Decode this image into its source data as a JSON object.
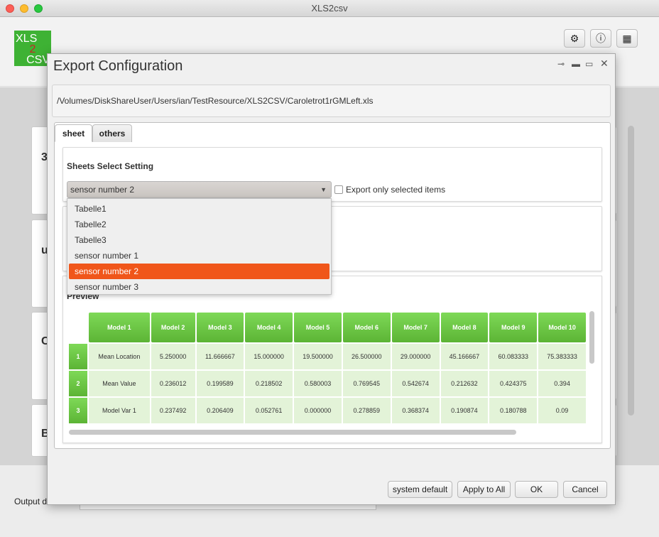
{
  "window": {
    "title": "XLS2csv"
  },
  "logo": {
    "line1": "XLS",
    "line2": "2",
    "line3": "CSV"
  },
  "header_icons": [
    "gear-icon",
    "alert-icon",
    "grid-icon"
  ],
  "background": {
    "letters": [
      "3",
      "u",
      "C",
      "B"
    ],
    "output_label": "Output d"
  },
  "dialog": {
    "title": "Export Configuration",
    "path": "/Volumes/DiskShareUser/Users/ian/TestResource/XLS2CSV/Caroletrot1rGMLeft.xls",
    "tabs": [
      {
        "label": "sheet",
        "active": true
      },
      {
        "label": "others",
        "active": false
      }
    ],
    "sheets_section_title": "Sheets Select Setting",
    "combo_value": "sensor number 2",
    "export_only_label": "Export only selected items",
    "export_only_checked": false,
    "dropdown_items": [
      "Tabelle1",
      "Tabelle2",
      "Tabelle3",
      "sensor number 1",
      "sensor number 2",
      "sensor number 3"
    ],
    "dropdown_selected_index": 4,
    "preview_title": "Preview",
    "table": {
      "headers": [
        "Model 1",
        "Model 2",
        "Model 3",
        "Model 4",
        "Model 5",
        "Model 6",
        "Model 7",
        "Model 8",
        "Model 9",
        "Model 10"
      ],
      "rows": [
        {
          "num": "1",
          "cells": [
            "Mean Location",
            "5.250000",
            "11.666667",
            "15.000000",
            "19.500000",
            "26.500000",
            "29.000000",
            "45.166667",
            "60.083333",
            "75.383333"
          ]
        },
        {
          "num": "2",
          "cells": [
            "Mean Value",
            "0.236012",
            "0.199589",
            "0.218502",
            "0.580003",
            "0.769545",
            "0.542674",
            "0.212632",
            "0.424375",
            "0.394"
          ]
        },
        {
          "num": "3",
          "cells": [
            "Model Var 1",
            "0.237492",
            "0.206409",
            "0.052761",
            "0.000000",
            "0.278859",
            "0.368374",
            "0.190874",
            "0.180788",
            "0.09"
          ]
        }
      ]
    },
    "buttons": {
      "system_default": "system default",
      "apply_all": "Apply to All",
      "ok": "OK",
      "cancel": "Cancel"
    },
    "accent_color": "#f0561a",
    "header_green": "#6cc744"
  }
}
